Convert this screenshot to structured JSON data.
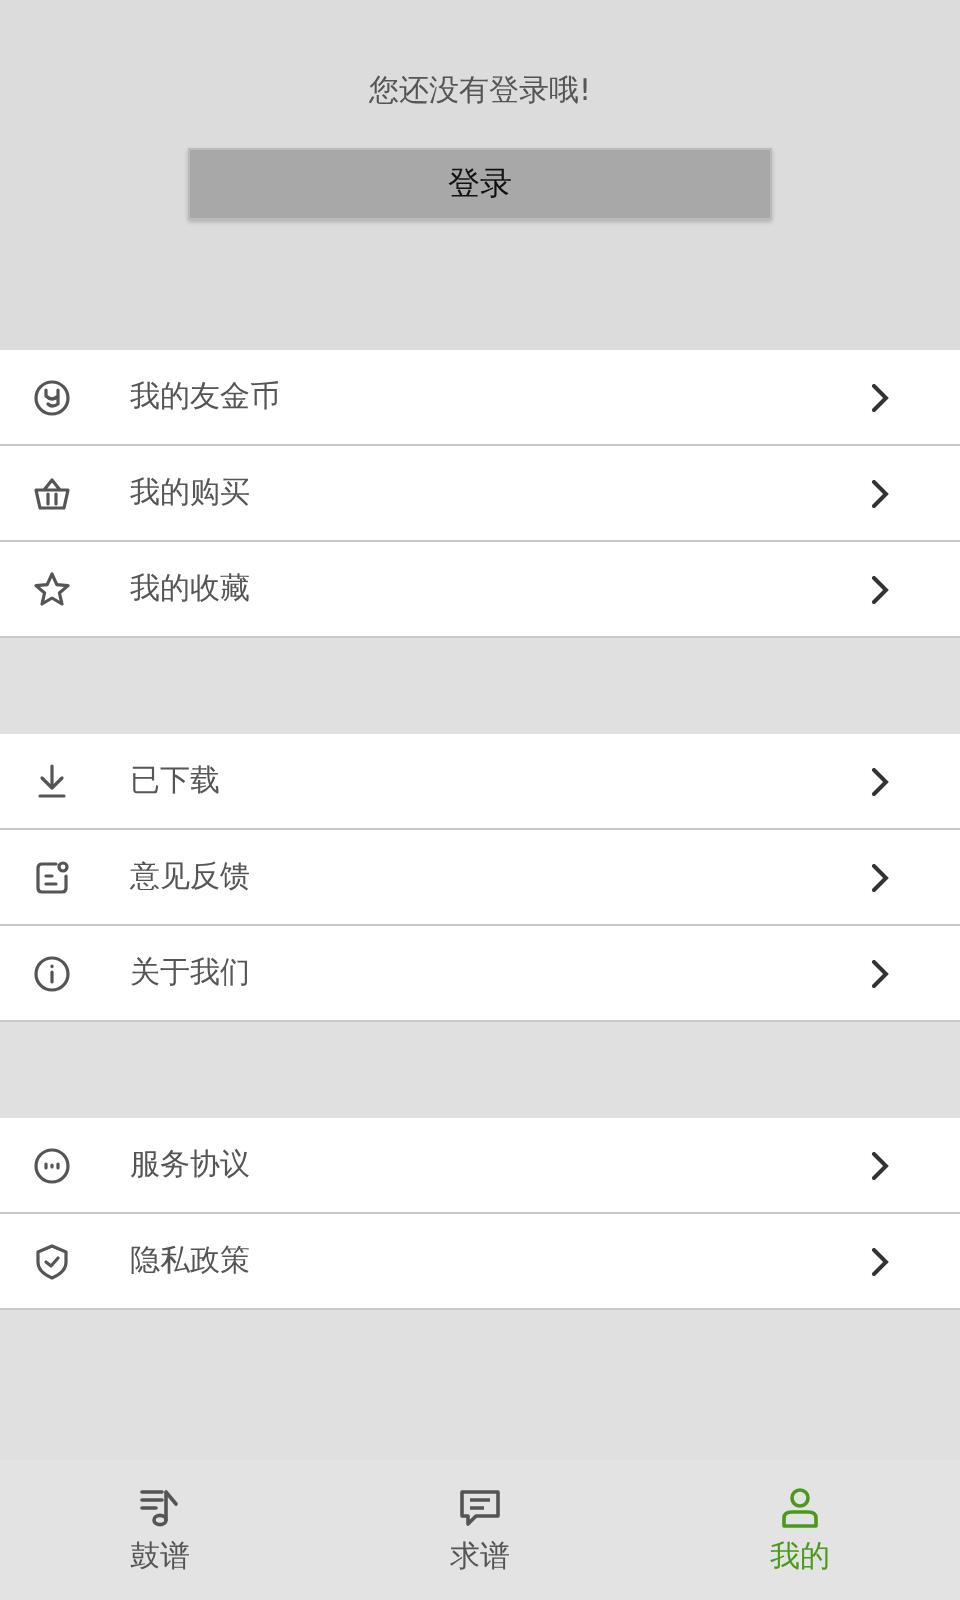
{
  "login": {
    "message": "您还没有登录哦!",
    "button": "登录"
  },
  "menu_groups": [
    {
      "items": [
        {
          "label": "我的友金币"
        },
        {
          "label": "我的购买"
        },
        {
          "label": "我的收藏"
        }
      ]
    },
    {
      "items": [
        {
          "label": "已下载"
        },
        {
          "label": "意见反馈"
        },
        {
          "label": "关于我们"
        }
      ]
    },
    {
      "items": [
        {
          "label": "服务协议"
        },
        {
          "label": "隐私政策"
        }
      ]
    }
  ],
  "bottom_nav": [
    {
      "label": "鼓谱",
      "selected": false
    },
    {
      "label": "求谱",
      "selected": false
    },
    {
      "label": "我的",
      "selected": true
    }
  ]
}
